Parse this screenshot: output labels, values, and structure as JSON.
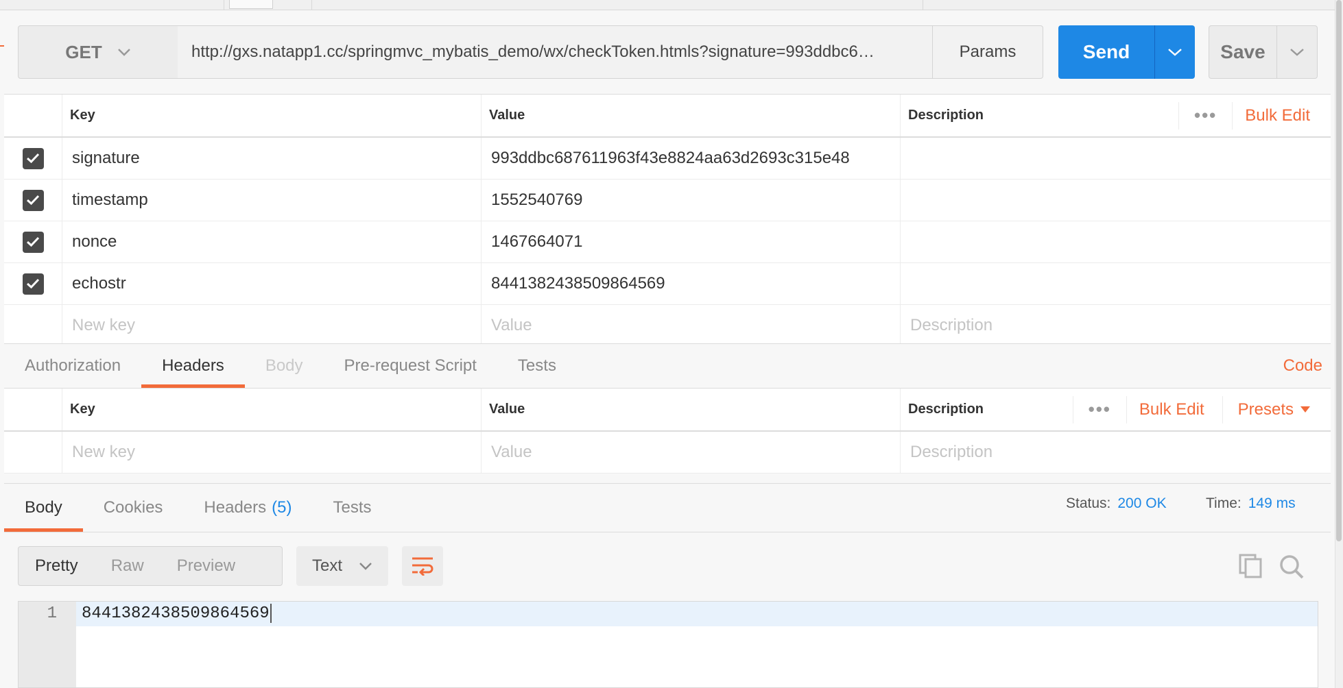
{
  "request": {
    "method": "GET",
    "url": "http://gxs.natapp1.cc/springmvc_mybatis_demo/wx/checkToken.htmls?signature=993ddbc6…",
    "params_label": "Params",
    "send_label": "Send",
    "save_label": "Save"
  },
  "params_table": {
    "col_key": "Key",
    "col_value": "Value",
    "col_description": "Description",
    "bulk_edit": "Bulk Edit",
    "rows": [
      {
        "key": "signature",
        "value": "993ddbc687611963f43e8824aa63d2693c315e48"
      },
      {
        "key": "timestamp",
        "value": "1552540769"
      },
      {
        "key": "nonce",
        "value": "1467664071"
      },
      {
        "key": "echostr",
        "value": "8441382438509864569"
      }
    ],
    "placeholder_key": "New key",
    "placeholder_value": "Value",
    "placeholder_description": "Description"
  },
  "request_tabs": {
    "authorization": "Authorization",
    "headers": "Headers",
    "body": "Body",
    "prerequest": "Pre-request Script",
    "tests": "Tests",
    "code": "Code"
  },
  "headers_table": {
    "col_key": "Key",
    "col_value": "Value",
    "col_description": "Description",
    "bulk_edit": "Bulk Edit",
    "presets": "Presets",
    "placeholder_key": "New key",
    "placeholder_value": "Value",
    "placeholder_description": "Description"
  },
  "response": {
    "tabs": {
      "body": "Body",
      "cookies": "Cookies",
      "headers": "Headers",
      "headers_count": "(5)",
      "tests": "Tests"
    },
    "status_label": "Status:",
    "status_value": "200 OK",
    "time_label": "Time:",
    "time_value": "149 ms",
    "view_modes": {
      "pretty": "Pretty",
      "raw": "Raw",
      "preview": "Preview"
    },
    "format": "Text",
    "line_number": "1",
    "body_text": "8441382438509864569"
  },
  "colors": {
    "accent": "#f26b3a",
    "primary": "#1e88e5"
  }
}
